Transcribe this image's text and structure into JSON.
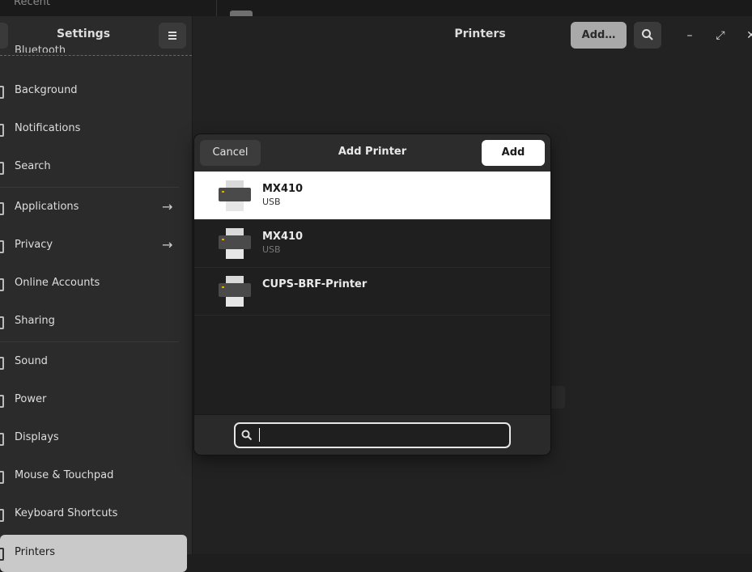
{
  "background": {
    "recent_label": "Recent"
  },
  "sidebar": {
    "title": "Settings",
    "cut_item": "Bluetooth",
    "items": [
      {
        "label": "Background",
        "arrow": ""
      },
      {
        "label": "Notifications",
        "arrow": ""
      },
      {
        "label": "Search",
        "arrow": ""
      },
      {
        "label": "Applications",
        "arrow": "→"
      },
      {
        "label": "Privacy",
        "arrow": "→"
      },
      {
        "label": "Online Accounts",
        "arrow": ""
      },
      {
        "label": "Sharing",
        "arrow": ""
      },
      {
        "label": "Sound",
        "arrow": ""
      },
      {
        "label": "Power",
        "arrow": ""
      },
      {
        "label": "Displays",
        "arrow": ""
      },
      {
        "label": "Mouse & Touchpad",
        "arrow": ""
      },
      {
        "label": "Keyboard Shortcuts",
        "arrow": ""
      },
      {
        "label": "Printers",
        "arrow": ""
      }
    ]
  },
  "header": {
    "title": "Printers",
    "add_label": "Add…",
    "window_controls": {
      "minimize": "–",
      "maximize": "⤢",
      "close": "✕"
    }
  },
  "dialog": {
    "title": "Add Printer",
    "cancel_label": "Cancel",
    "add_label": "Add",
    "printers": [
      {
        "name": "MX410",
        "desc": "USB",
        "selected": true
      },
      {
        "name": "MX410",
        "desc": "USB",
        "selected": false
      },
      {
        "name": "CUPS-BRF-Printer",
        "desc": "",
        "selected": false
      }
    ],
    "search": {
      "value": "",
      "placeholder": ""
    }
  },
  "colors": {
    "selected_bg": "#ffffff",
    "accent_led": "#e0b000",
    "sidebar_selected": "#c9c9c9"
  }
}
